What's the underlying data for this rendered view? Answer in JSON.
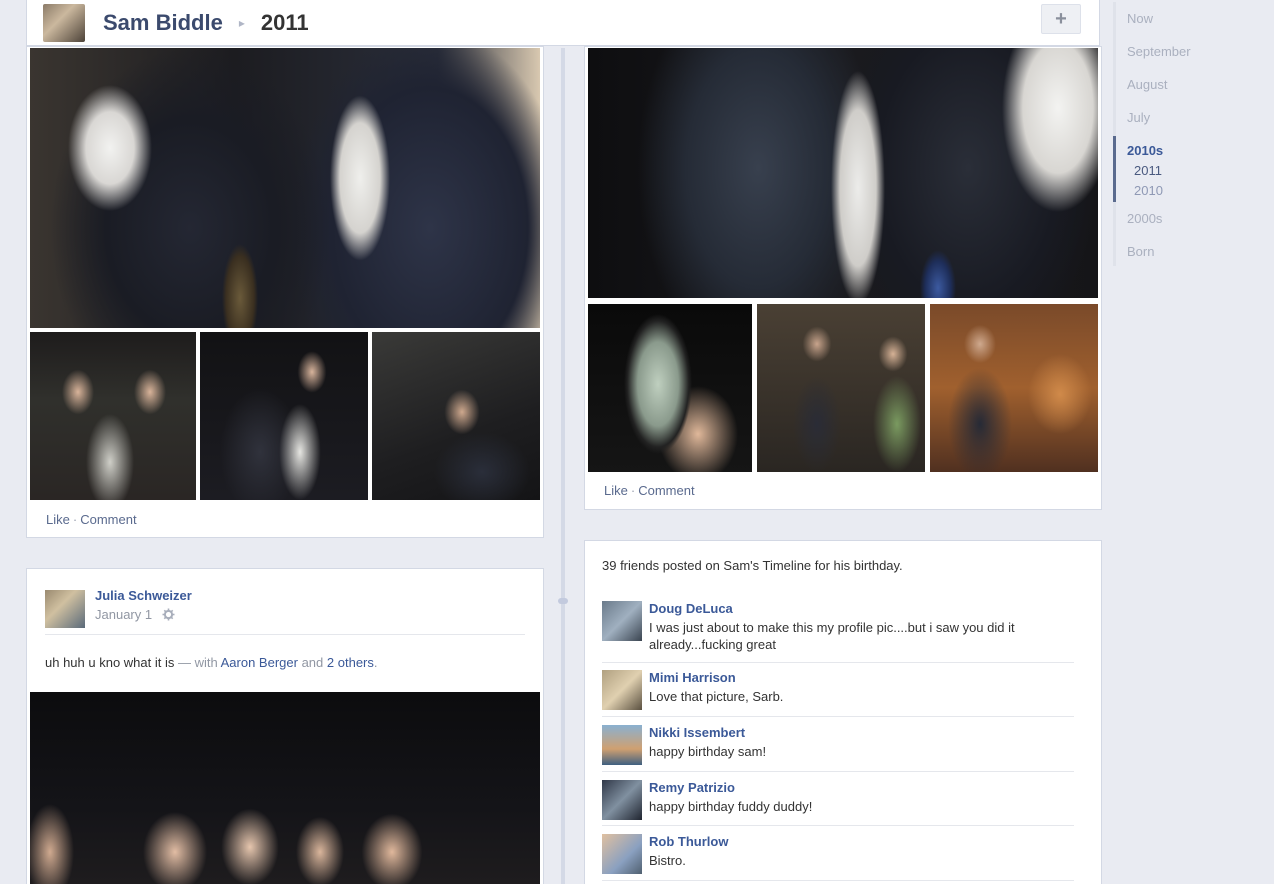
{
  "header": {
    "name": "Sam Biddle",
    "year": "2011",
    "separator": "▸",
    "plus": "+"
  },
  "left_photo_card": {
    "actions": {
      "like": "Like",
      "dot": "·",
      "comment": "Comment"
    }
  },
  "right_photo_card": {
    "actions": {
      "like": "Like",
      "dot": "·",
      "comment": "Comment"
    }
  },
  "julia_post": {
    "author": "Julia Schweizer",
    "date": "January 1",
    "settings_icon": "gear-icon",
    "text": "uh huh u kno what it is",
    "with_prefix": "— with",
    "tag1": "Aaron Berger",
    "and": "and",
    "tag2": "2 others",
    "period": "."
  },
  "birthday_card": {
    "intro": "39 friends posted on Sam's Timeline for his birthday.",
    "posts": [
      {
        "name": "Doug DeLuca",
        "message": "I was just about to make this my profile pic....but i saw you did it already...fucking great"
      },
      {
        "name": "Mimi Harrison",
        "message": "Love that picture, Sarb."
      },
      {
        "name": "Nikki Issembert",
        "message": "happy birthday sam!"
      },
      {
        "name": "Remy Patrizio",
        "message": "happy birthday fuddy duddy!"
      },
      {
        "name": "Rob Thurlow",
        "message": "Bistro."
      }
    ]
  },
  "scrubber": {
    "items": [
      "Now",
      "September",
      "August",
      "July",
      "2010s",
      "2011",
      "2010",
      "2000s",
      "Born"
    ],
    "active": "2010s",
    "current_year": "2011"
  }
}
